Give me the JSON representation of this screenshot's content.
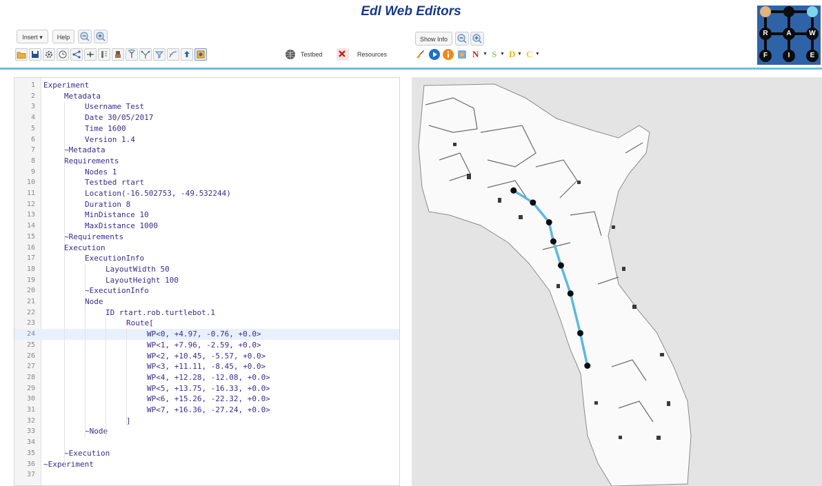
{
  "app": {
    "title": "Edl Web Editors"
  },
  "toolbar_left": {
    "insert_label": "Insert ▾",
    "help_label": "Help",
    "testbed_label": "Testbed",
    "resources_label": "Resources"
  },
  "toolbar_right": {
    "show_info_label": "Show Info",
    "letters": [
      {
        "text": "N",
        "color": "#d01c1c"
      },
      {
        "text": "S",
        "color": "#8fd36a"
      },
      {
        "text": "D",
        "color": "#f0b400"
      },
      {
        "text": "C",
        "color": "#e0cf33"
      }
    ]
  },
  "logo": {
    "letters": [
      "R",
      "A",
      "W",
      "F",
      "I",
      "E"
    ]
  },
  "editor": {
    "highlighted_line": 24,
    "lines": [
      {
        "n": "1",
        "indent": 0,
        "text": "Experiment"
      },
      {
        "n": "2",
        "indent": 1,
        "text": "Metadata"
      },
      {
        "n": "3",
        "indent": 2,
        "text": "Username Test"
      },
      {
        "n": "4",
        "indent": 2,
        "text": "Date 30/05/2017"
      },
      {
        "n": "5",
        "indent": 2,
        "text": "Time 1600"
      },
      {
        "n": "6",
        "indent": 2,
        "text": "Version 1.4"
      },
      {
        "n": "7",
        "indent": 1,
        "text": "~Metadata"
      },
      {
        "n": "8",
        "indent": 1,
        "text": "Requirements"
      },
      {
        "n": "9",
        "indent": 2,
        "text": "Nodes 1"
      },
      {
        "n": "10",
        "indent": 2,
        "text": "Testbed rtart"
      },
      {
        "n": "11",
        "indent": 2,
        "text": "Location(-16.502753, -49.532244)"
      },
      {
        "n": "12",
        "indent": 2,
        "text": "Duration 8"
      },
      {
        "n": "13",
        "indent": 2,
        "text": "MinDistance 10"
      },
      {
        "n": "14",
        "indent": 2,
        "text": "MaxDistance 1000"
      },
      {
        "n": "15",
        "indent": 1,
        "text": "~Requirements"
      },
      {
        "n": "16",
        "indent": 1,
        "text": "Execution"
      },
      {
        "n": "17",
        "indent": 2,
        "text": "ExecutionInfo"
      },
      {
        "n": "18",
        "indent": 3,
        "text": "LayoutWidth 50"
      },
      {
        "n": "19",
        "indent": 3,
        "text": "LayoutHeight 100"
      },
      {
        "n": "20",
        "indent": 2,
        "text": "~ExecutionInfo"
      },
      {
        "n": "21",
        "indent": 2,
        "text": "Node"
      },
      {
        "n": "22",
        "indent": 3,
        "text": "ID rtart.rob.turtlebot.1"
      },
      {
        "n": "23",
        "indent": 4,
        "text": "Route["
      },
      {
        "n": "24",
        "indent": 5,
        "text": "WP<0, +4.97, -0.76, +0.0>"
      },
      {
        "n": "25",
        "indent": 5,
        "text": "WP<1, +7.96, -2.59, +0.0>"
      },
      {
        "n": "26",
        "indent": 5,
        "text": "WP<2, +10.45, -5.57, +0.0>"
      },
      {
        "n": "27",
        "indent": 5,
        "text": "WP<3, +11.11, -8.45, +0.0>"
      },
      {
        "n": "28",
        "indent": 5,
        "text": "WP<4, +12.28, -12.08, +0.0>"
      },
      {
        "n": "29",
        "indent": 5,
        "text": "WP<5, +13.75, -16.33, +0.0>"
      },
      {
        "n": "30",
        "indent": 5,
        "text": "WP<6, +15.26, -22.32, +0.0>"
      },
      {
        "n": "31",
        "indent": 5,
        "text": "WP<7, +16.36, -27.24, +0.0>"
      },
      {
        "n": "32",
        "indent": 4,
        "text": "]"
      },
      {
        "n": "33",
        "indent": 2,
        "text": "~Node"
      },
      {
        "n": "34",
        "indent": 0,
        "text": ""
      },
      {
        "n": "35",
        "indent": 1,
        "text": "~Execution"
      },
      {
        "n": "36",
        "indent": 0,
        "text": "~Experiment"
      },
      {
        "n": "37",
        "indent": 0,
        "text": ""
      }
    ]
  },
  "map": {
    "route_color": "#5bb8e0",
    "waypoint_color": "#0d0d0d"
  }
}
